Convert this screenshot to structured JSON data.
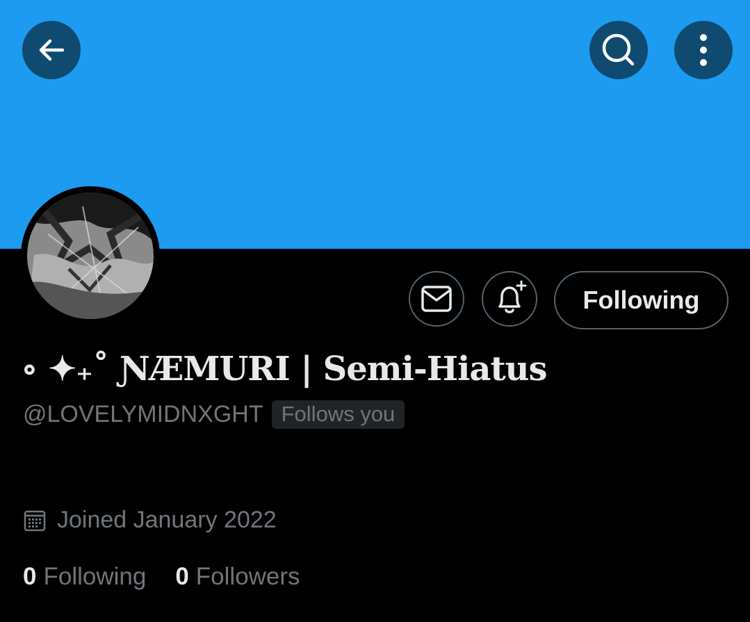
{
  "colors": {
    "banner": "#1d9bf0",
    "background": "#000000",
    "overlay_button": "#0f4a70",
    "primary_text": "#e7e9ea",
    "secondary_text": "#71767b",
    "border": "#536471"
  },
  "header": {
    "back_icon": "arrow-left-icon",
    "search_icon": "search-icon",
    "more_icon": "more-vertical-icon"
  },
  "actions": {
    "message_icon": "envelope-icon",
    "notify_icon": "bell-plus-icon",
    "following_label": "Following"
  },
  "profile": {
    "display_name": "∘ ✦₊˚ ƝÆMURI | Semi-Hiatus",
    "handle": "@LOVELYMIDNXGHT",
    "follows_you": "Follows you",
    "joined": "Joined January 2022",
    "joined_icon": "calendar-icon",
    "following_count": "0",
    "following_label": "Following",
    "followers_count": "0",
    "followers_label": "Followers"
  }
}
